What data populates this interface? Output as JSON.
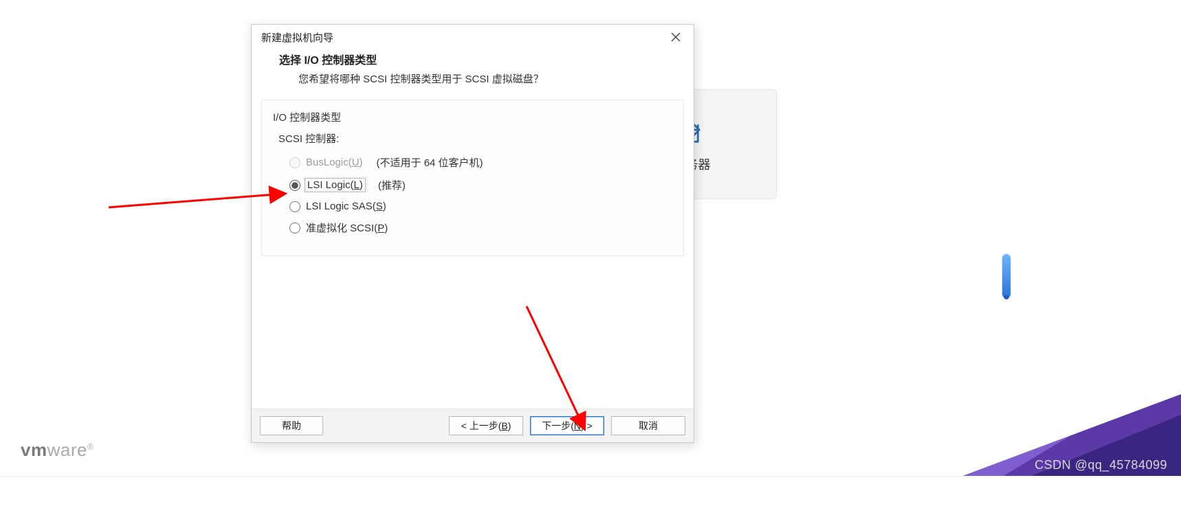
{
  "dialog": {
    "window_title": "新建虚拟机向导",
    "header_title": "选择 I/O 控制器类型",
    "header_sub": "您希望将哪种 SCSI 控制器类型用于 SCSI 虚拟磁盘？",
    "group_title": "I/O 控制器类型",
    "scsi_label": "SCSI 控制器:",
    "options": {
      "buslogic": {
        "label_pre": "BusLogic(",
        "shortcut": "U",
        "label_post": ")",
        "note": "(不适用于 64 位客户机)"
      },
      "lsi": {
        "label_pre": "LSI Logic(",
        "shortcut": "L",
        "label_post": ")",
        "note": "(推荐)"
      },
      "lsisas": {
        "label_pre": "LSI Logic SAS(",
        "shortcut": "S",
        "label_post": ")"
      },
      "paravirt": {
        "label_pre": "准虚拟化 SCSI(",
        "shortcut": "P",
        "label_post": ")"
      }
    },
    "buttons": {
      "help": "帮助",
      "back_pre": "< 上一步(",
      "back_key": "B",
      "back_post": ")",
      "next_pre": "下一步(",
      "next_key": "N",
      "next_post": ") >",
      "cancel": "取消"
    }
  },
  "back_card_text": "程服务器",
  "logo_text": "vmware",
  "watermark": "CSDN @qq_45784099"
}
